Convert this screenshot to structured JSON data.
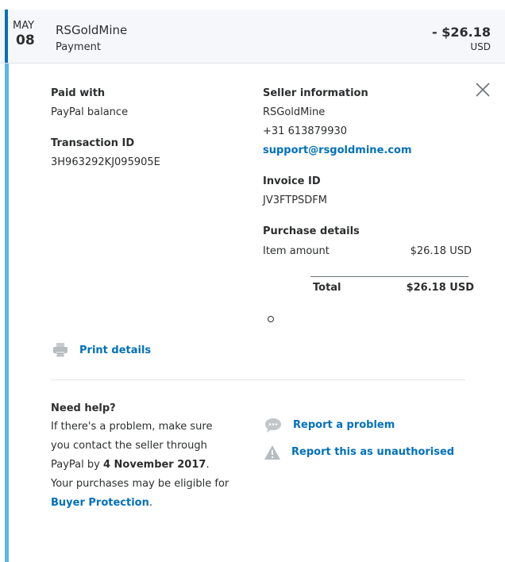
{
  "header": {
    "month": "MAY",
    "day": "08",
    "merchant": "RSGoldMine",
    "type": "Payment",
    "amount": "- $26.18",
    "currency": "USD"
  },
  "paid_with": {
    "label": "Paid with",
    "value": "PayPal balance"
  },
  "transaction": {
    "label": "Transaction ID",
    "value": "3H963292KJ095905E"
  },
  "seller": {
    "label": "Seller information",
    "name": "RSGoldMine",
    "phone": "+31 613879930",
    "email": "support@rsgoldmine.com"
  },
  "invoice": {
    "label": "Invoice ID",
    "value": "JV3FTPSDFM"
  },
  "purchase": {
    "label": "Purchase details",
    "item_label": "Item amount",
    "item_value": "$26.18 USD",
    "total_label": "Total",
    "total_value": "$26.18 USD"
  },
  "print": {
    "label": "Print details",
    "icon": "printer-icon"
  },
  "help": {
    "title": "Need help?",
    "text_1": "If there's a problem, make sure you contact the seller through PayPal by ",
    "deadline": "4 November 2017",
    "text_2": ". Your purchases may be eligible for ",
    "link": "Buyer Protection",
    "text_3": "."
  },
  "actions": {
    "report_problem": "Report a problem",
    "report_unauthorised": "Report this as unauthorised"
  },
  "colors": {
    "accent": "#0070ba",
    "detail_bar": "#5bb7e8",
    "header_bg": "#f5f7fa",
    "icon_gray": "#b7bcbf"
  }
}
